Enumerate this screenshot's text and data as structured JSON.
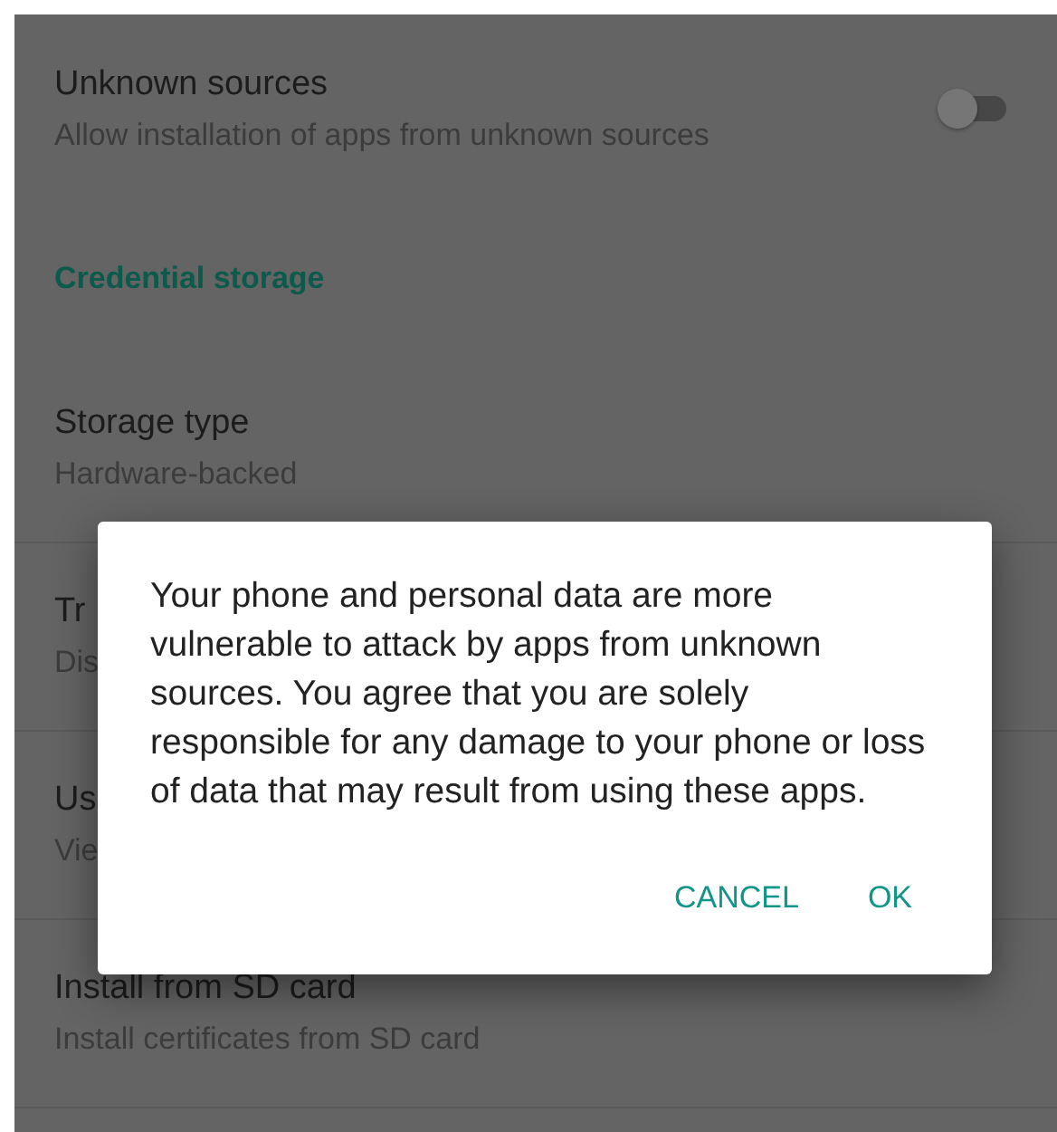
{
  "settings": [
    {
      "kind": "switch",
      "title": "Unknown sources",
      "summary": "Allow installation of apps from unknown sources",
      "on": false
    },
    {
      "kind": "header",
      "title": "Credential storage"
    },
    {
      "kind": "item",
      "title": "Storage type",
      "summary": "Hardware-backed"
    },
    {
      "kind": "item",
      "title": "Tr",
      "summary": "Dis"
    },
    {
      "kind": "item",
      "title": "Us",
      "summary": "Vie"
    },
    {
      "kind": "item",
      "title": "Install from SD card",
      "summary": "Install certificates from SD card"
    }
  ],
  "dialog": {
    "message": "Your phone and personal data are more vulnerable to attack by apps from unknown sources. You agree that you are solely responsible for any damage to your phone or loss of data that may result from using these apps.",
    "buttons": [
      "CANCEL",
      "OK"
    ]
  }
}
